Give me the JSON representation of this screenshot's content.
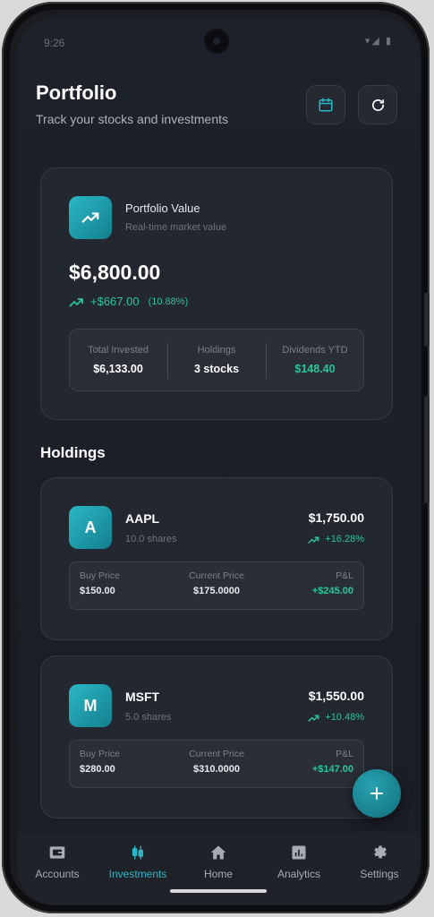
{
  "status": {
    "time": "9:26",
    "icons": "▾◢ ▮"
  },
  "header": {
    "title": "Portfolio",
    "subtitle": "Track your stocks and investments"
  },
  "portfolio": {
    "label": "Portfolio Value",
    "sublabel": "Real-time market value",
    "value": "$6,800.00",
    "change": "+$667.00",
    "change_pct": "(10.88%)",
    "stats": [
      {
        "label": "Total Invested",
        "value": "$6,133.00"
      },
      {
        "label": "Holdings",
        "value": "3 stocks"
      },
      {
        "label": "Dividends YTD",
        "value": "$148.40"
      }
    ]
  },
  "holdings_title": "Holdings",
  "holdings": [
    {
      "letter": "A",
      "symbol": "AAPL",
      "shares": "10.0 shares",
      "value": "$1,750.00",
      "pct": "+16.28%",
      "buy_label": "Buy Price",
      "buy": "$150.00",
      "cur_label": "Current Price",
      "cur": "$175.0000",
      "pl_label": "P&L",
      "pl": "+$245.00"
    },
    {
      "letter": "M",
      "symbol": "MSFT",
      "shares": "5.0 shares",
      "value": "$1,550.00",
      "pct": "+10.48%",
      "buy_label": "Buy Price",
      "buy": "$280.00",
      "cur_label": "Current Price",
      "cur": "$310.0000",
      "pl_label": "P&L",
      "pl": "+$147.00"
    }
  ],
  "nav": [
    {
      "label": "Accounts",
      "icon": "wallet-icon"
    },
    {
      "label": "Investments",
      "icon": "candlestick-icon"
    },
    {
      "label": "Home",
      "icon": "home-icon"
    },
    {
      "label": "Analytics",
      "icon": "analytics-icon"
    },
    {
      "label": "Settings",
      "icon": "gear-icon"
    }
  ],
  "colors": {
    "accent": "#29b6c6",
    "positive": "#27c59a",
    "background": "#1c1f27",
    "card": "#23272f"
  }
}
